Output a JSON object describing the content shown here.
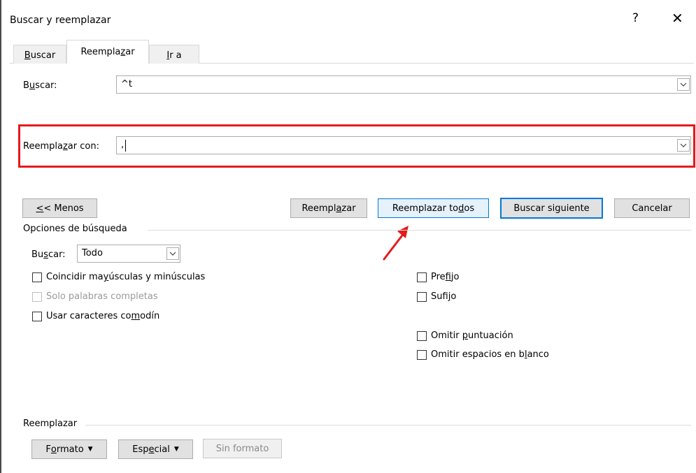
{
  "window": {
    "title": "Buscar y reemplazar",
    "help_label": "?",
    "close_label": "✕"
  },
  "tabs": [
    {
      "label_pre": "",
      "label_u": "B",
      "label_post": "uscar",
      "active": false
    },
    {
      "label_pre": "Reempla",
      "label_u": "z",
      "label_post": "ar",
      "active": true
    },
    {
      "label_pre": "",
      "label_u": "I",
      "label_post": "r a",
      "active": false
    }
  ],
  "find": {
    "label_pre": "B",
    "label_u": "u",
    "label_post": "scar:",
    "value": "^t"
  },
  "replace": {
    "label_pre": "Reempla",
    "label_u": "z",
    "label_post": "ar con:",
    "value": ","
  },
  "buttons": {
    "less_u": "<",
    "less_post": "< Menos",
    "replace_pre": "Reempl",
    "replace_u": "a",
    "replace_post": "zar",
    "replace_all_pre": "Reemplazar to",
    "replace_all_u": "d",
    "replace_all_post": "os",
    "find_next_pre": "Buscar si",
    "find_next_u": "g",
    "find_next_post": "uiente",
    "cancel": "Cancelar"
  },
  "options": {
    "title": "Opciones de búsqueda",
    "search_pre": "Bu",
    "search_u": "s",
    "search_post": "car:",
    "search_value": "Todo",
    "match_case_pre": "Coincidir ma",
    "match_case_u": "y",
    "match_case_post": "úsculas y minúsculas",
    "whole_words": "Solo palabras completas",
    "wildcards_pre": "Usar caracteres co",
    "wildcards_u": "m",
    "wildcards_post": "odín",
    "prefix_pre": "Pre",
    "prefix_u": "f",
    "prefix_post": "ijo",
    "suffix_pre": "Sufi",
    "suffix_u": "j",
    "suffix_post": "o",
    "ignore_punct_pre": "Omitir ",
    "ignore_punct_u": "p",
    "ignore_punct_post": "untuación",
    "ignore_space_pre": "Omitir espacios en b",
    "ignore_space_u": "l",
    "ignore_space_post": "anco"
  },
  "replace_section": {
    "title": "Reemplazar",
    "format_pre": "F",
    "format_u": "o",
    "format_post": "rmato",
    "special_pre": "Esp",
    "special_u": "e",
    "special_post": "cial",
    "no_format": "Sin formato"
  },
  "colors": {
    "annotation_red": "#e41b1b",
    "focus_blue": "#0078d7"
  }
}
